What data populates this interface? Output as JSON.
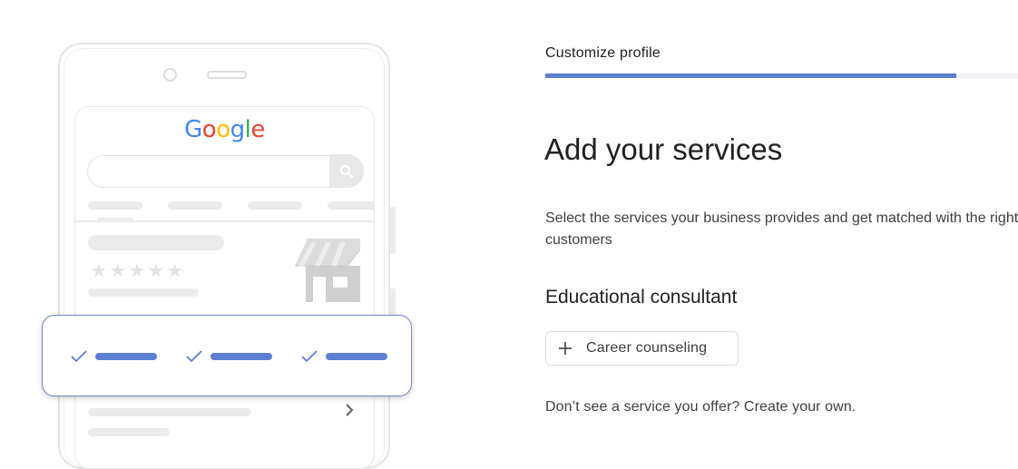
{
  "illustration": {
    "logo_letters": [
      {
        "ch": "G",
        "color": "#4285f4"
      },
      {
        "ch": "o",
        "color": "#ea4335"
      },
      {
        "ch": "o",
        "color": "#fbbc05"
      },
      {
        "ch": "g",
        "color": "#4285f4"
      },
      {
        "ch": "l",
        "color": "#34a853"
      },
      {
        "ch": "e",
        "color": "#ea4335"
      }
    ],
    "stars": "★★★★★",
    "check_accent": "#5b7fd1"
  },
  "header": {
    "step_label": "Customize profile",
    "progress_fraction": 0.87
  },
  "main": {
    "heading": "Add your services",
    "description": "Select the services your business provides and get matched with the right customers",
    "category": "Educational consultant",
    "service_chip": {
      "icon": "plus-icon",
      "label": "Career counseling"
    },
    "footer_prompt": "Don’t see a service you offer?",
    "footer_link": "Create your own."
  }
}
